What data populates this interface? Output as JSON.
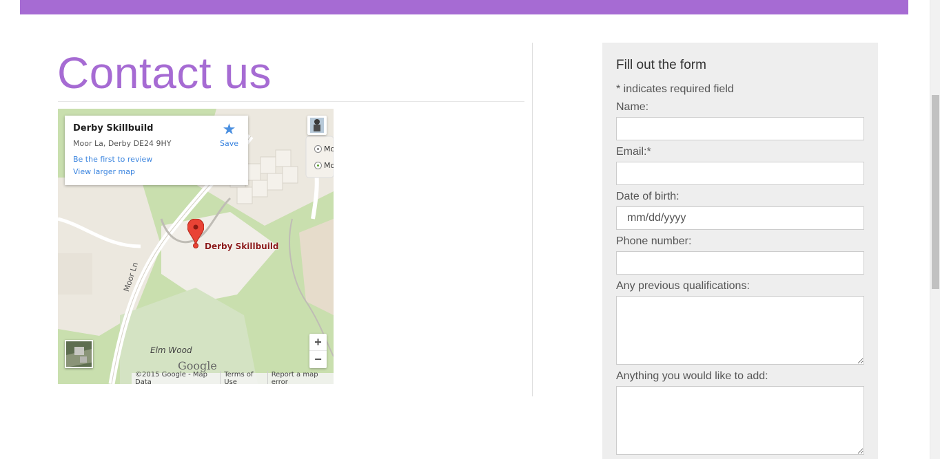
{
  "page": {
    "title": "Contact us",
    "accent_color": "#a66bd3"
  },
  "map": {
    "place_name": "Derby Skillbuild",
    "address": "Moor La, Derby DE24 9HY",
    "review_link": "Be the first to review",
    "larger_map_link": "View larger map",
    "save_label": "Save",
    "marker_label": "Derby Skillbuild",
    "road_label": "Moor Ln",
    "wood_label": "Elm Wood",
    "poi_1": "Mo",
    "poi_2": "Mo",
    "logo_text": "Google",
    "zoom_in": "+",
    "zoom_out": "−",
    "footer": {
      "copyright": "©2015 Google - Map Data",
      "terms": "Terms of Use",
      "report": "Report a map error"
    }
  },
  "form": {
    "heading": "Fill out the form",
    "required_note": "* indicates required field",
    "fields": {
      "name_label": "Name:",
      "email_label": "Email:*",
      "dob_label": "Date of birth:",
      "dob_placeholder": "mm/dd/yyyy",
      "phone_label": "Phone number:",
      "qualifications_label": "Any previous qualifications:",
      "additional_label": "Anything you would like to add:"
    }
  }
}
